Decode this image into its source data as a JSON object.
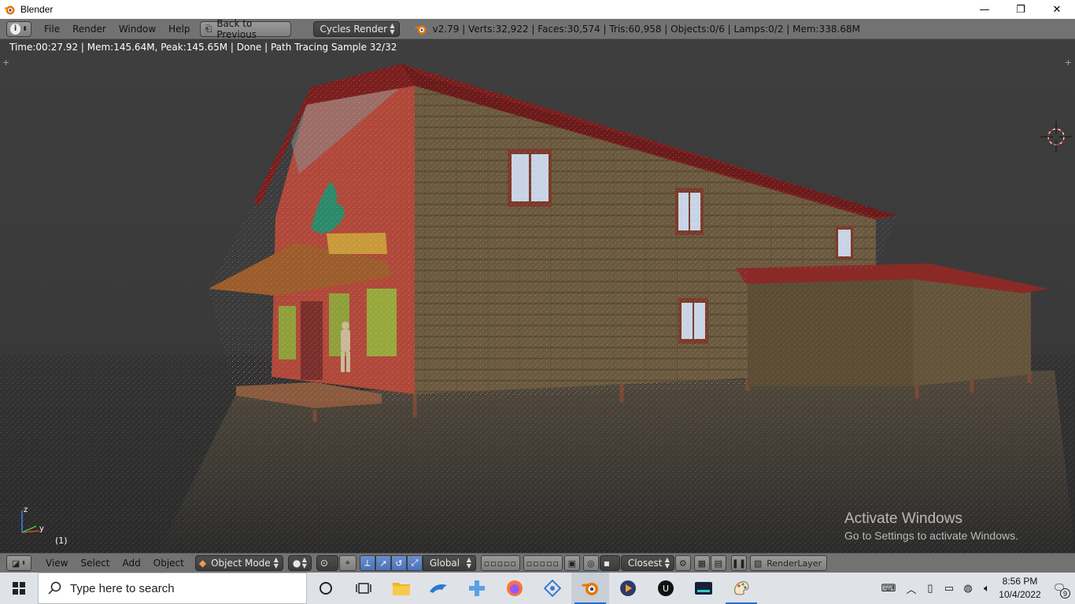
{
  "window": {
    "title": "Blender",
    "min": "—",
    "max": "❐",
    "close": "✕"
  },
  "infobar": {
    "menus": [
      "File",
      "Render",
      "Window",
      "Help"
    ],
    "back_button": "Back to Previous",
    "engine": "Cycles Render",
    "stats": "v2.79 | Verts:32,922 | Faces:30,574 | Tris:60,958 | Objects:0/6 | Lamps:0/2 | Mem:338.68M"
  },
  "viewport": {
    "render_status": "Time:00:27.92 | Mem:145.64M, Peak:145.65M | Done | Path Tracing Sample 32/32",
    "frame": "(1)",
    "axis": {
      "x": "x",
      "y": "y",
      "z": "z"
    },
    "watermark": {
      "line1": "Activate Windows",
      "line2": "Go to Settings to activate Windows."
    }
  },
  "view_header": {
    "menus": [
      "View",
      "Select",
      "Add",
      "Object"
    ],
    "mode": "Object Mode",
    "orientation": "Global",
    "snap": "Closest",
    "render_layer": "RenderLayer"
  },
  "taskbar": {
    "search_placeholder": "Type here to search",
    "time": "8:56 PM",
    "date": "10/4/2022",
    "notification_count": "9"
  },
  "colors": {
    "ui_gray": "#727272",
    "viewport_bg": "#3c3c3c",
    "wall_red": "#b0483a",
    "siding_brown": "#6b5a3f",
    "roof_red": "#7a1e1e",
    "taskbar_bg": "#dfe3e8",
    "accent_blue": "#2a6ed3"
  }
}
